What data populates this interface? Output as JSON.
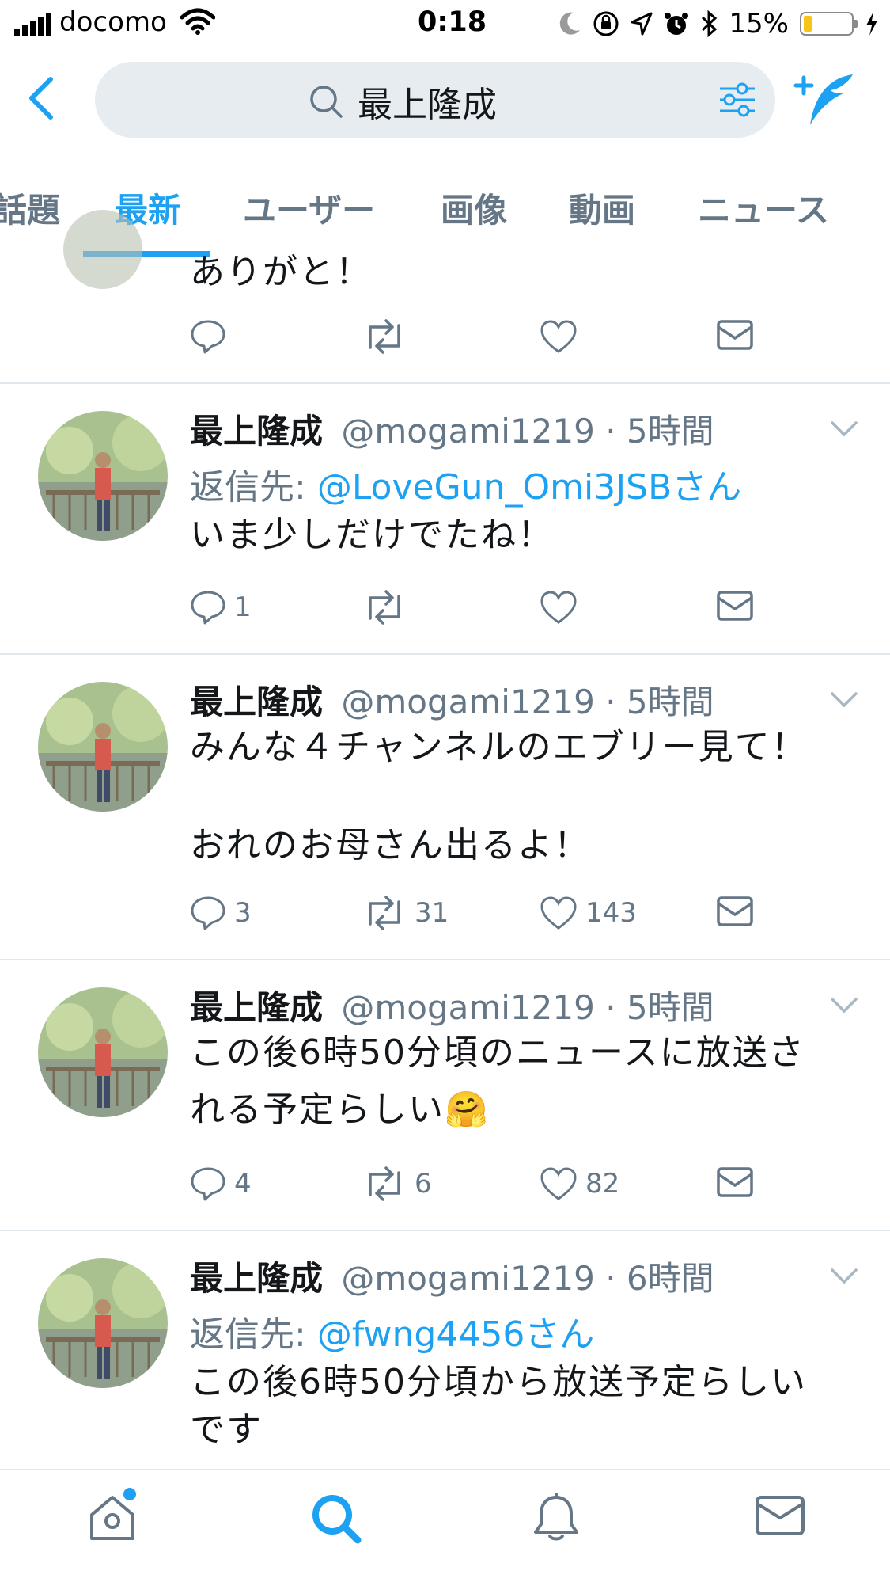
{
  "status_bar": {
    "carrier": "docomo",
    "time": "0:18",
    "battery_percent": "15%",
    "battery_level": 0.15
  },
  "search": {
    "query": "最上隆成"
  },
  "tabs": [
    {
      "label": "話題",
      "active": false
    },
    {
      "label": "最新",
      "active": true
    },
    {
      "label": "ユーザー",
      "active": false
    },
    {
      "label": "画像",
      "active": false
    },
    {
      "label": "動画",
      "active": false
    },
    {
      "label": "ニュース",
      "active": false
    }
  ],
  "partial_tweet": {
    "text": "ありがと！"
  },
  "tweets": [
    {
      "name": "最上隆成",
      "meta": "@mogami1219 · 5時間",
      "reply_label": "返信先: ",
      "reply_handle": "@LoveGun_Omi3JSBさん",
      "text": "いま少しだけでたね！",
      "replies": "1",
      "retweets": "",
      "likes": ""
    },
    {
      "name": "最上隆成",
      "meta": "@mogami1219 · 5時間",
      "text_line1": "みんな４チャンネルのエブリー見て！",
      "text_line2": "おれのお母さん出るよ！",
      "replies": "3",
      "retweets": "31",
      "likes": "143"
    },
    {
      "name": "最上隆成",
      "meta": "@mogami1219 · 5時間",
      "text_line1": "この後6時50分頃のニュースに放送さ",
      "text_line2": "れる予定らしい🤗",
      "replies": "4",
      "retweets": "6",
      "likes": "82"
    },
    {
      "name": "最上隆成",
      "meta": "@mogami1219 · 6時間",
      "reply_label": "返信先: ",
      "reply_handle": "@fwng4456さん",
      "text_line1": "この後6時50分頃から放送予定らしい",
      "text_line2": "です"
    }
  ],
  "icons": [
    "signal-icon",
    "wifi-icon",
    "moon-icon",
    "rotation-lock-icon",
    "location-icon",
    "alarm-icon",
    "bluetooth-icon",
    "battery-icon",
    "charging-icon",
    "back-icon",
    "search-icon",
    "filter-icon",
    "compose-icon",
    "reply-icon",
    "retweet-icon",
    "like-icon",
    "dm-icon",
    "chevron-down-icon",
    "home-icon",
    "explore-icon",
    "notifications-icon",
    "messages-icon"
  ],
  "colors": {
    "accent": "#1da1f2",
    "muted": "#657786",
    "divider": "#e1e8ed",
    "search_bg": "#e6ecf0"
  }
}
